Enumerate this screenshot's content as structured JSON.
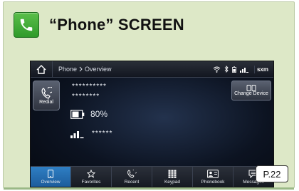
{
  "header": {
    "title": "“Phone” SCREEN",
    "icon": "phone-icon"
  },
  "screen": {
    "breadcrumb": {
      "first": "Phone",
      "second": "Overview"
    },
    "status": {
      "brand": "sxm"
    },
    "redial_label": "Redial",
    "change_device_label": "Change Device",
    "number_line1": "**********",
    "number_line2": "********",
    "battery_text": "80%",
    "signal_text": "******",
    "tabs": [
      {
        "label": "Overview",
        "icon": "phone-icon",
        "active": true
      },
      {
        "label": "Favorites",
        "icon": "star-icon",
        "active": false
      },
      {
        "label": "Recent",
        "icon": "recent-call-icon",
        "active": false
      },
      {
        "label": "Keypad",
        "icon": "keypad-icon",
        "active": false
      },
      {
        "label": "Phonebook",
        "icon": "phonebook-icon",
        "active": false
      },
      {
        "label": "Messages",
        "icon": "messages-icon",
        "active": false
      }
    ]
  },
  "page_ref": "P.22",
  "colors": {
    "card_bg": "#dde8c7",
    "badge_green": "#3da535",
    "tab_active": "#2f7fc4"
  }
}
